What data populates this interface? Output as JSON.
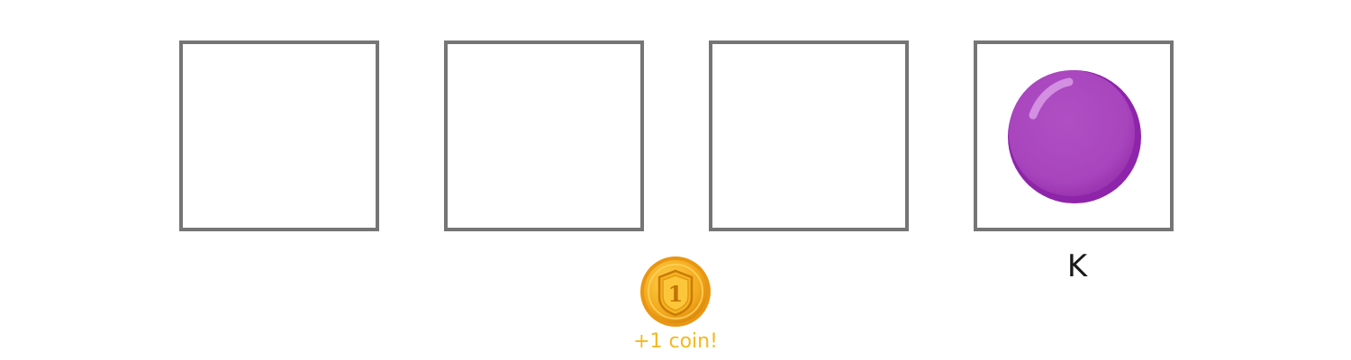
{
  "slots": [
    {
      "id": 1,
      "filled": false
    },
    {
      "id": 2,
      "filled": false
    },
    {
      "id": 3,
      "filled": false
    },
    {
      "id": 4,
      "filled": true,
      "gem_icon": "purple-orb-icon",
      "key_label": "K"
    }
  ],
  "reward": {
    "icon": "gold-coin-icon",
    "coin_number": "1",
    "text": "+1 coin!"
  },
  "colors": {
    "slot_border": "#757575",
    "gem_fill": "#a845bd",
    "gem_shadow": "#8e24aa",
    "coin_text": "#f5b91e",
    "coin_gold": "#f2a81d"
  }
}
